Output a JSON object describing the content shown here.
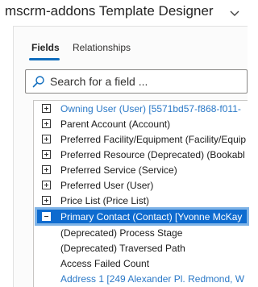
{
  "window": {
    "title": "mscrm-addons Template Designer"
  },
  "tabs": [
    {
      "label": "Fields",
      "active": true
    },
    {
      "label": "Relationships",
      "active": false
    }
  ],
  "search": {
    "placeholder": "Search for a field ..."
  },
  "tree": {
    "rows": [
      {
        "label": "Owning User (User) [5571bd57-f868-f011-",
        "expandable": true,
        "expanded": false,
        "style": "link"
      },
      {
        "label": "Parent Account (Account)",
        "expandable": true,
        "expanded": false,
        "style": "normal"
      },
      {
        "label": "Preferred Facility/Equipment (Facility/Equip",
        "expandable": true,
        "expanded": false,
        "style": "normal"
      },
      {
        "label": "Preferred Resource (Deprecated) (Bookabl",
        "expandable": true,
        "expanded": false,
        "style": "normal"
      },
      {
        "label": "Preferred Service (Service)",
        "expandable": true,
        "expanded": false,
        "style": "normal"
      },
      {
        "label": "Preferred User (User)",
        "expandable": true,
        "expanded": false,
        "style": "normal"
      },
      {
        "label": "Price List (Price List)",
        "expandable": true,
        "expanded": false,
        "style": "normal"
      },
      {
        "label": "Primary Contact (Contact) [Yvonne McKay",
        "expandable": true,
        "expanded": true,
        "style": "selected"
      },
      {
        "label": "(Deprecated) Process Stage",
        "expandable": false,
        "style": "normal"
      },
      {
        "label": "(Deprecated) Traversed Path",
        "expandable": false,
        "style": "normal"
      },
      {
        "label": "Access Failed Count",
        "expandable": false,
        "style": "normal"
      },
      {
        "label": "Address 1 [249 Alexander Pl. Redmond, W",
        "expandable": false,
        "style": "link"
      }
    ]
  },
  "colors": {
    "accent": "#0f6cbd",
    "link": "#2b79c7",
    "selection": "#0e6bcf"
  }
}
